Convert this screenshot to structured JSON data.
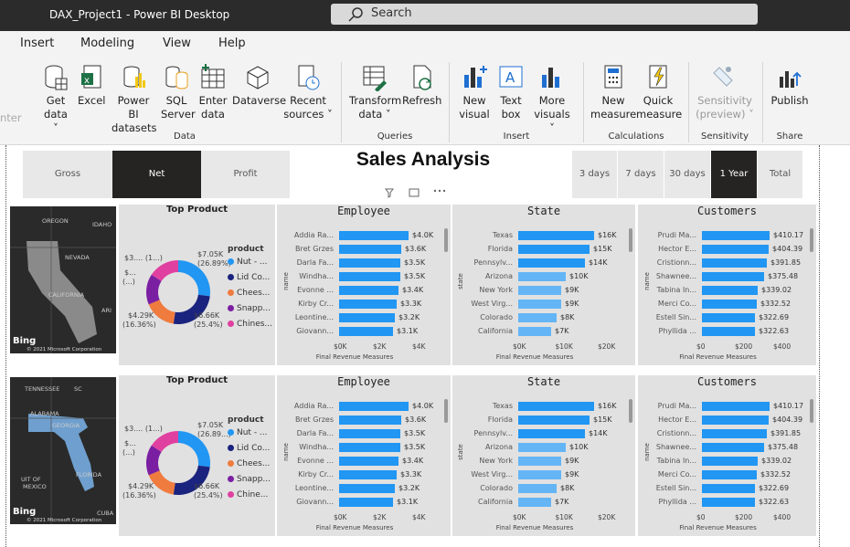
{
  "window": {
    "title": "DAX_Project1 - Power BI Desktop",
    "search_placeholder": "Search"
  },
  "menu": [
    "Insert",
    "Modeling",
    "View",
    "Help"
  ],
  "ribbon": {
    "left_cut": "nter",
    "items": [
      {
        "l1": "Get",
        "l2": "data ˅"
      },
      {
        "l1": "Excel",
        "l2": ""
      },
      {
        "l1": "Power BI",
        "l2": "datasets"
      },
      {
        "l1": "SQL",
        "l2": "Server"
      },
      {
        "l1": "Enter",
        "l2": "data"
      },
      {
        "l1": "Dataverse",
        "l2": ""
      },
      {
        "l1": "Recent",
        "l2": "sources ˅"
      },
      {
        "l1": "Transform",
        "l2": "data ˅"
      },
      {
        "l1": "Refresh",
        "l2": ""
      },
      {
        "l1": "New",
        "l2": "visual"
      },
      {
        "l1": "Text",
        "l2": "box"
      },
      {
        "l1": "More",
        "l2": "visuals ˅"
      },
      {
        "l1": "New",
        "l2": "measure"
      },
      {
        "l1": "Quick",
        "l2": "measure"
      },
      {
        "l1": "Sensitivity",
        "l2": "(preview) ˅"
      },
      {
        "l1": "Publish",
        "l2": ""
      }
    ],
    "groups": [
      "Data",
      "Queries",
      "Insert",
      "Calculations",
      "Sensitivity",
      "Share"
    ]
  },
  "report": {
    "title": "Sales Analysis",
    "measure_buttons": [
      "Gross",
      "Net",
      "Profit"
    ],
    "period_buttons": [
      "3 days",
      "7 days",
      "30 days",
      "1 Year",
      "Total"
    ],
    "selected_measure": "Net",
    "selected_period": "1 Year"
  },
  "rows": [
    {
      "map": {
        "labels": [
          "OREGON",
          "IDAHO",
          "NEVADA",
          "CALIFORNIA",
          "ARI"
        ],
        "bing": "Bing",
        "copyright": "© 2021 Microsoft Corporation"
      },
      "donut": {
        "title": "Top Product",
        "legend_title": "product",
        "legend": [
          {
            "label": "Nut - ...",
            "color": "#2196f3"
          },
          {
            "label": "Lid Co...",
            "color": "#1a237e"
          },
          {
            "label": "Chees...",
            "color": "#f07b3f"
          },
          {
            "label": "Snapp...",
            "color": "#7b1fa2"
          },
          {
            "label": "Chines...",
            "color": "#e040a0"
          }
        ],
        "values": [
          27,
          25.4,
          16.36,
          15.5,
          15.74
        ],
        "lbl_tr1": "$7.05K",
        "lbl_tr2": "(26.89%)",
        "lbl_br1": "$6.66K",
        "lbl_br2": "(25.4%)",
        "lbl_bl1": "$4.29K",
        "lbl_bl2": "(16.36%)",
        "lbl_tl1": "$3.... (1...)",
        "lbl_tl2": "$...",
        "lbl_tl3": "(...)"
      },
      "employee": {
        "title": "Employee",
        "axis": "name",
        "xlabel": "Final Revenue Measures",
        "ticks": [
          "$0K",
          "$2K",
          "$4K"
        ],
        "names": [
          "Addia Ra...",
          "Bret Grzes",
          "Darla Fa...",
          "Windha...",
          "Evonne ...",
          "Kirby Cr...",
          "Leontine...",
          "Giovann..."
        ],
        "labels": [
          "$4.0K",
          "$3.6K",
          "$3.5K",
          "$3.5K",
          "$3.4K",
          "$3.3K",
          "$3.2K",
          "$3.1K"
        ],
        "values": [
          4.0,
          3.6,
          3.5,
          3.5,
          3.4,
          3.3,
          3.2,
          3.1
        ],
        "max": 4.0
      },
      "state": {
        "title": "State",
        "axis": "state",
        "xlabel": "Final Revenue Measures",
        "ticks": [
          "$0K",
          "$10K",
          "$20K"
        ],
        "names": [
          "Texas",
          "Florida",
          "Pennsylv...",
          "Arizona",
          "New York",
          "West Virg...",
          "Colorado",
          "California"
        ],
        "labels": [
          "$16K",
          "$15K",
          "$14K",
          "$10K",
          "$9K",
          "$9K",
          "$8K",
          "$7K"
        ],
        "values": [
          16,
          15,
          14,
          10,
          9,
          9,
          8,
          7
        ],
        "max": 16
      },
      "customers": {
        "title": "Customers",
        "axis": "name",
        "xlabel": "Final Revenue Measures",
        "ticks": [
          "$0",
          "$200",
          "$400"
        ],
        "names": [
          "Prudi Ma...",
          "Hector E...",
          "Cristionn...",
          "Shawnee...",
          "Tabina In...",
          "Merci Co...",
          "Estell Sin...",
          "Phyllida ..."
        ],
        "labels": [
          "$410.17",
          "$404.39",
          "$391.85",
          "$375.48",
          "$339.02",
          "$332.52",
          "$322.69",
          "$322.63"
        ],
        "values": [
          410.17,
          404.39,
          391.85,
          375.48,
          339.02,
          332.52,
          322.69,
          322.63
        ],
        "max": 410.17
      }
    },
    {
      "map": {
        "labels": [
          "TENNESSEE",
          "SC",
          "ALABAMA",
          "GEORGIA",
          "FLORIDA",
          "UIT OF",
          "MEXICO",
          "CUBA"
        ],
        "bing": "Bing",
        "copyright": "© 2021 Microsoft Corporation"
      },
      "donut": {
        "title": "Top Product",
        "legend_title": "product",
        "legend": [
          {
            "label": "Nut - ...",
            "color": "#2196f3"
          },
          {
            "label": "Lid Co...",
            "color": "#1a237e"
          },
          {
            "label": "Chees...",
            "color": "#f07b3f"
          },
          {
            "label": "Snapp...",
            "color": "#7b1fa2"
          },
          {
            "label": "Chine...",
            "color": "#e040a0"
          }
        ],
        "values": [
          27,
          25.4,
          16.36,
          15.5,
          15.74
        ],
        "lbl_tr1": "$7.05K",
        "lbl_tr2": "(26.89...)",
        "lbl_br1": "$6.66K",
        "lbl_br2": "(25.4%)",
        "lbl_bl1": "$4.29K",
        "lbl_bl2": "(16.36%)",
        "lbl_tl1": "$3.... (1...)",
        "lbl_tl2": "$...",
        "lbl_tl3": "(...)"
      },
      "employee": {
        "title": "Employee",
        "axis": "name",
        "xlabel": "Final Revenue Measures",
        "ticks": [
          "$0K",
          "$2K",
          "$4K"
        ],
        "names": [
          "Addia Ra...",
          "Bret Grzes",
          "Darla Fa...",
          "Windha...",
          "Evonne ...",
          "Kirby Cr...",
          "Leontine...",
          "Giovann..."
        ],
        "labels": [
          "$4.0K",
          "$3.6K",
          "$3.5K",
          "$3.5K",
          "$3.4K",
          "$3.3K",
          "$3.2K",
          "$3.1K"
        ],
        "values": [
          4.0,
          3.6,
          3.5,
          3.5,
          3.4,
          3.3,
          3.2,
          3.1
        ],
        "max": 4.0
      },
      "state": {
        "title": "State",
        "axis": "state",
        "xlabel": "Final Revenue Measures",
        "ticks": [
          "$0K",
          "$10K",
          "$20K"
        ],
        "names": [
          "Texas",
          "Florida",
          "Pennsylv...",
          "Arizona",
          "New York",
          "West Virg...",
          "Colorado",
          "California"
        ],
        "labels": [
          "$16K",
          "$15K",
          "$14K",
          "$10K",
          "$9K",
          "$9K",
          "$8K",
          "$7K"
        ],
        "values": [
          16,
          15,
          14,
          10,
          9,
          9,
          8,
          7
        ],
        "max": 16
      },
      "customers": {
        "title": "Customers",
        "axis": "name",
        "xlabel": "Final Revenue Measures",
        "ticks": [
          "$0",
          "$200",
          "$400"
        ],
        "names": [
          "Prudi Ma...",
          "Hector E...",
          "Cristionn...",
          "Shawnee...",
          "Tabina In...",
          "Merci Co...",
          "Estell Sin...",
          "Phyllida ..."
        ],
        "labels": [
          "$410.17",
          "$404.39",
          "$391.85",
          "$375.48",
          "$339.02",
          "$332.52",
          "$322.69",
          "$322.63"
        ],
        "values": [
          410.17,
          404.39,
          391.85,
          375.48,
          339.02,
          332.52,
          322.69,
          322.63
        ],
        "max": 410.17
      }
    }
  ],
  "colors": {
    "bar_dark": "#2196f3",
    "bar_light": "#64b5f6",
    "panel": "#e1e1e1",
    "selected": "#252423"
  }
}
